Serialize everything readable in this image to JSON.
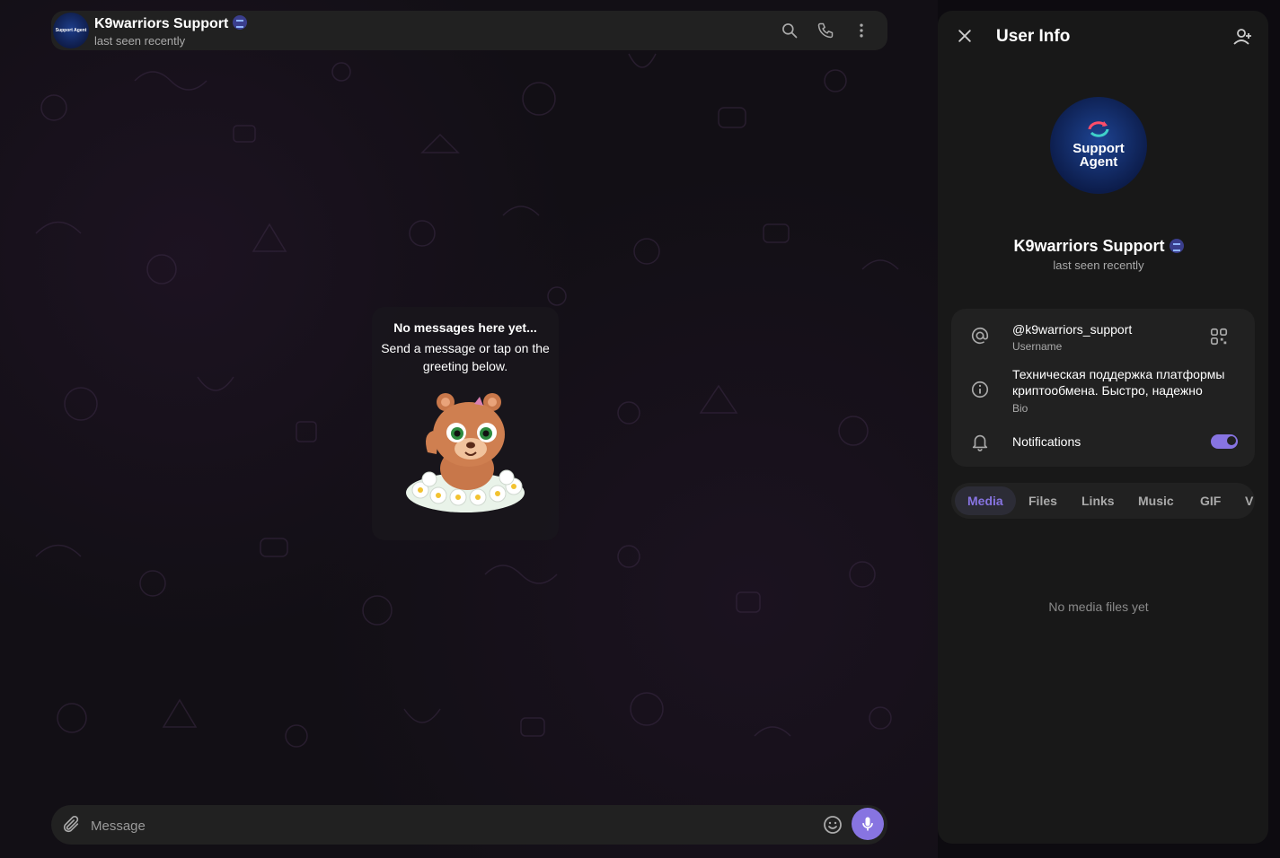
{
  "chat": {
    "name": "K9warriors Support",
    "status": "last seen recently",
    "avatar_text": "Support Agent"
  },
  "empty_state": {
    "title": "No messages here yet...",
    "subtitle": "Send a message or tap on the greeting below."
  },
  "composer": {
    "placeholder": "Message"
  },
  "panel": {
    "title": "User Info",
    "name": "K9warriors Support",
    "status": "last seen recently",
    "avatar_line1": "Support",
    "avatar_line2": "Agent",
    "username": "@k9warriors_support",
    "username_label": "Username",
    "bio_line1": "Техническая поддержка платформы",
    "bio_line2": "криптообмена. Быстро, надежно",
    "bio_label": "Bio",
    "notifications_label": "Notifications",
    "notifications_on": true,
    "tabs": [
      "Media",
      "Files",
      "Links",
      "Music",
      "GIF",
      "V"
    ],
    "empty_media": "No media files yet"
  },
  "colors": {
    "accent": "#8774e1",
    "surface": "#212121",
    "panel": "#181818",
    "background": "#120f15"
  },
  "icons": [
    "search-icon",
    "phone-icon",
    "more-icon",
    "attach-icon",
    "emoji-icon",
    "mic-icon",
    "close-icon",
    "add-contact-icon",
    "at-icon",
    "qr-icon",
    "info-icon",
    "bell-icon",
    "verified-icon"
  ]
}
